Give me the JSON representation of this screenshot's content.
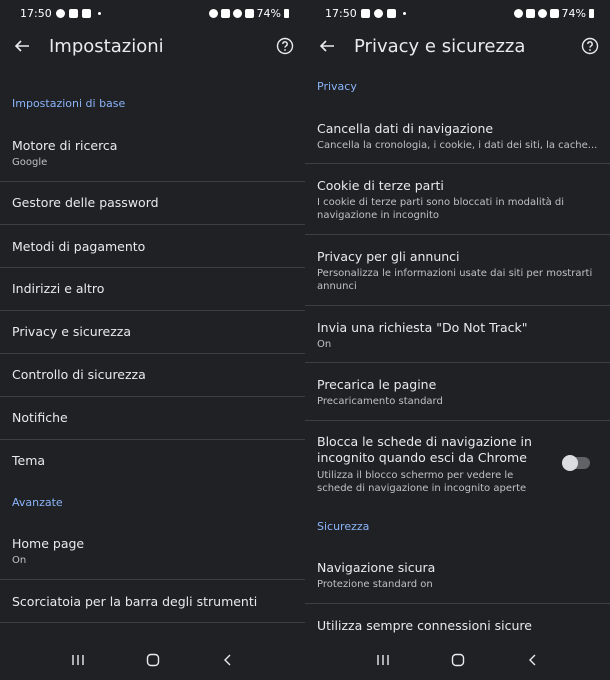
{
  "status_bar": {
    "time": "17:50",
    "battery": "74%"
  },
  "left": {
    "title": "Impostazioni",
    "sections": {
      "basic": "Impostazioni di base",
      "advanced": "Avanzate"
    },
    "items": [
      {
        "title": "Motore di ricerca",
        "summary": "Google"
      },
      {
        "title": "Gestore delle password"
      },
      {
        "title": "Metodi di pagamento"
      },
      {
        "title": "Indirizzi e altro"
      },
      {
        "title": "Privacy e sicurezza"
      },
      {
        "title": "Controllo di sicurezza"
      },
      {
        "title": "Notifiche"
      },
      {
        "title": "Tema"
      },
      {
        "title": "Home page",
        "summary": "On"
      },
      {
        "title": "Scorciatoia per la barra degli strumenti"
      }
    ]
  },
  "right": {
    "title": "Privacy e sicurezza",
    "sections": {
      "privacy": "Privacy",
      "security": "Sicurezza"
    },
    "items": [
      {
        "title": "Cancella dati di navigazione",
        "summary": "Cancella la cronologia, i cookie, i dati dei siti, la cache..."
      },
      {
        "title": "Cookie di terze parti",
        "summary": "I cookie di terze parti sono bloccati in modalità di navigazione in incognito"
      },
      {
        "title": "Privacy per gli annunci",
        "summary": "Personalizza le informazioni usate dai siti per mostrarti annunci"
      },
      {
        "title": "Invia una richiesta \"Do Not Track\"",
        "summary": "On"
      },
      {
        "title": "Precarica le pagine",
        "summary": "Precaricamento standard"
      },
      {
        "title": "Blocca le schede di navigazione in incognito quando esci da Chrome",
        "summary": "Utilizza il blocco schermo per vedere le schede di navigazione in incognito aperte",
        "toggle": false
      },
      {
        "title": "Navigazione sicura",
        "summary": "Protezione standard on"
      },
      {
        "title": "Utilizza sempre connessioni sicure"
      }
    ]
  }
}
